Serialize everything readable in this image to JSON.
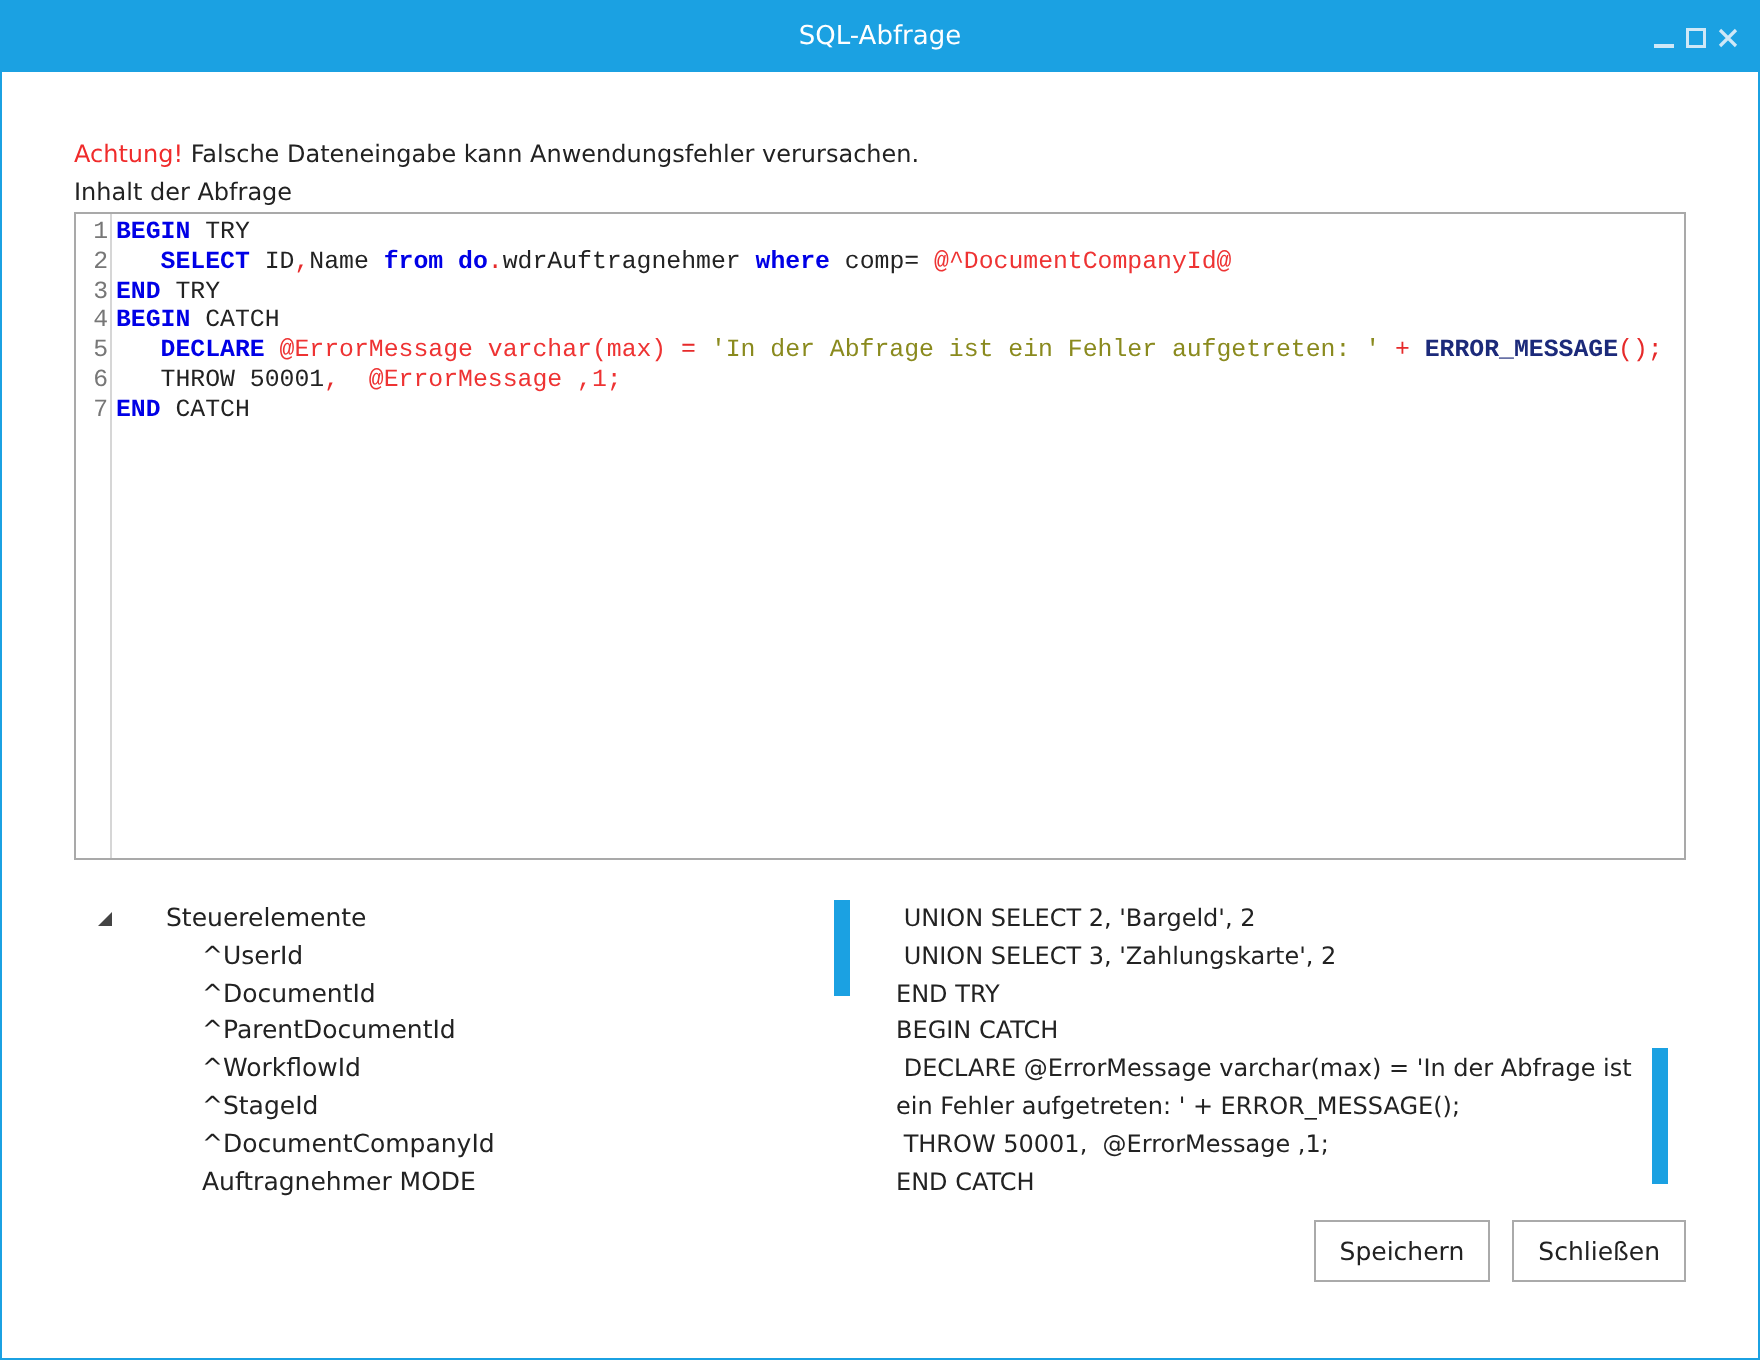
{
  "window": {
    "title": "SQL-Abfrage"
  },
  "warning": {
    "label": "Achtung!",
    "text": "Falsche Dateneingabe kann Anwendungsfehler verursachen."
  },
  "editor": {
    "label": "Inhalt der Abfrage",
    "lines": [
      {
        "number": "1",
        "tokens": [
          {
            "kind": "kw",
            "text": "BEGIN"
          },
          {
            "kind": "plain",
            "text": " TRY"
          }
        ]
      },
      {
        "number": "2",
        "tokens": [
          {
            "kind": "kw",
            "text": "   SELECT"
          },
          {
            "kind": "plain",
            "text": " ID"
          },
          {
            "kind": "op",
            "text": ","
          },
          {
            "kind": "plain",
            "text": "Name "
          },
          {
            "kind": "kw",
            "text": "from do"
          },
          {
            "kind": "op",
            "text": "."
          },
          {
            "kind": "plain",
            "text": "wdrAuftragnehmer "
          },
          {
            "kind": "kw",
            "text": "where"
          },
          {
            "kind": "plain",
            "text": " comp= "
          },
          {
            "kind": "var",
            "text": "@^DocumentCompanyId@"
          }
        ]
      },
      {
        "number": "3",
        "tokens": [
          {
            "kind": "kw",
            "text": "END"
          },
          {
            "kind": "plain",
            "text": " TRY"
          }
        ]
      },
      {
        "number": "4",
        "tokens": [
          {
            "kind": "kw",
            "text": "BEGIN"
          },
          {
            "kind": "plain",
            "text": " CATCH"
          }
        ]
      },
      {
        "number": "5",
        "tokens": [
          {
            "kind": "kw",
            "text": "   DECLARE "
          },
          {
            "kind": "var",
            "text": "@ErrorMessage varchar(max)"
          },
          {
            "kind": "op",
            "text": " = "
          },
          {
            "kind": "str",
            "text": "'In der Abfrage ist ein Fehler aufgetreten: '"
          },
          {
            "kind": "op",
            "text": " + "
          },
          {
            "kind": "fn",
            "text": "ERROR_MESSAGE"
          },
          {
            "kind": "op",
            "text": "();"
          }
        ]
      },
      {
        "number": "6",
        "tokens": [
          {
            "kind": "plain",
            "text": "   THROW 50001"
          },
          {
            "kind": "op",
            "text": ",  "
          },
          {
            "kind": "var",
            "text": "@ErrorMessage ,1;"
          }
        ]
      },
      {
        "number": "7",
        "tokens": [
          {
            "kind": "kw",
            "text": "END"
          },
          {
            "kind": "plain",
            "text": " CATCH"
          }
        ]
      }
    ]
  },
  "tree": [
    {
      "label": "Steuerelemente",
      "expanded": true,
      "children": [
        {
          "label": "^UserId"
        },
        {
          "label": "^DocumentId"
        },
        {
          "label": "^ParentDocumentId"
        },
        {
          "label": "^WorkflowId"
        },
        {
          "label": "^StageId"
        },
        {
          "label": "^DocumentCompanyId"
        },
        {
          "label": "Auftragnehmer MODE"
        }
      ]
    }
  ],
  "preview": {
    "lines": [
      " UNION SELECT 2, 'Bargeld', 2",
      " UNION SELECT 3, 'Zahlungskarte', 2",
      "END TRY",
      "BEGIN CATCH",
      " DECLARE @ErrorMessage varchar(max) = 'In der Abfrage ist ein Fehler aufgetreten: ' + ERROR_MESSAGE();",
      " THROW 50001,  @ErrorMessage ,1;",
      "END CATCH"
    ]
  },
  "buttons": [
    {
      "label": "Speichern"
    },
    {
      "label": "Schließen"
    }
  ]
}
